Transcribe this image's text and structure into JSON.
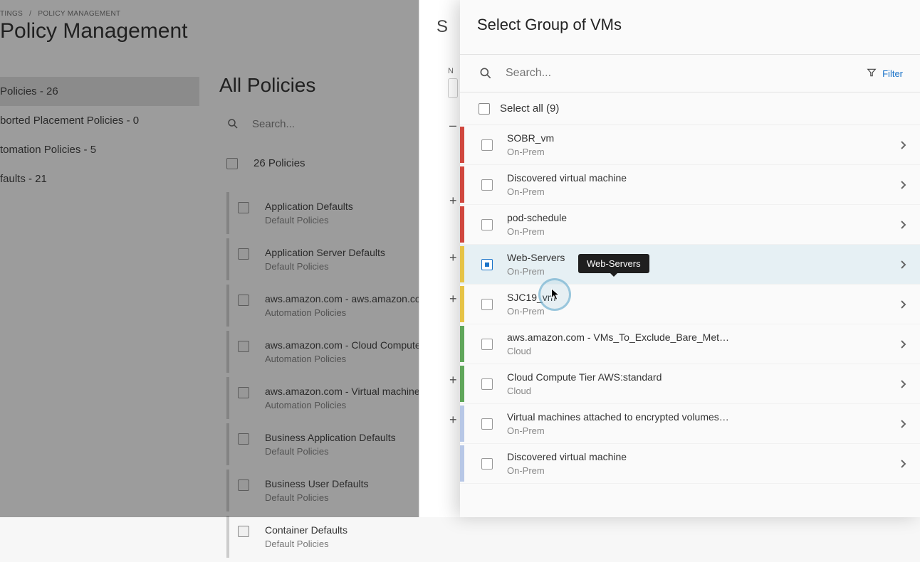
{
  "breadcrumb": {
    "a": "TINGS",
    "b": "POLICY MANAGEMENT"
  },
  "page_title": "Policy Management",
  "sidebar": {
    "items": [
      {
        "label": "Policies - 26"
      },
      {
        "label": "borted Placement Policies - 0"
      },
      {
        "label": "tomation Policies - 5"
      },
      {
        "label": "faults - 21"
      }
    ]
  },
  "mid": {
    "title": "All Policies",
    "search_placeholder": "Search...",
    "count_label": "26 Policies",
    "items": [
      {
        "name": "Application Defaults",
        "type": "Default Policies"
      },
      {
        "name": "Application Server Defaults",
        "type": "Default Policies"
      },
      {
        "name": "aws.amazon.com - aws.amazon.com - VM",
        "type": "Automation Policies"
      },
      {
        "name": "aws.amazon.com - Cloud Compute Tier A",
        "type": "Automation Policies"
      },
      {
        "name": "aws.amazon.com - Virtual machines attac",
        "type": "Automation Policies"
      },
      {
        "name": "Business Application Defaults",
        "type": "Default Policies"
      },
      {
        "name": "Business User Defaults",
        "type": "Default Policies"
      },
      {
        "name": "Container Defaults",
        "type": "Default Policies"
      }
    ]
  },
  "sheet1": {
    "peek_char": "S",
    "n_label": "N"
  },
  "panel": {
    "title": "Select Group of VMs",
    "search_placeholder": "Search...",
    "filter_label": "Filter",
    "select_all_label": "Select all (9)",
    "tooltip": "Web-Servers",
    "items": [
      {
        "name": "SOBR_vm",
        "sub": "On-Prem",
        "color": "red",
        "checked": false
      },
      {
        "name": "Discovered virtual machine",
        "sub": "On-Prem",
        "color": "red",
        "checked": false
      },
      {
        "name": "pod-schedule",
        "sub": "On-Prem",
        "color": "red",
        "checked": false
      },
      {
        "name": "Web-Servers",
        "sub": "On-Prem",
        "color": "yellow",
        "checked": true,
        "selected": true
      },
      {
        "name": "SJC19_vm",
        "sub": "On-Prem",
        "color": "yellow",
        "checked": false
      },
      {
        "name": "aws.amazon.com - VMs_To_Exclude_Bare_Met…",
        "sub": "Cloud",
        "color": "green",
        "checked": false
      },
      {
        "name": "Cloud Compute Tier AWS:standard",
        "sub": "Cloud",
        "color": "green",
        "checked": false
      },
      {
        "name": "Virtual machines attached to encrypted volumes…",
        "sub": "On-Prem",
        "color": "blue",
        "checked": false
      },
      {
        "name": "Discovered virtual machine",
        "sub": "On-Prem",
        "color": "blue",
        "checked": false
      }
    ]
  }
}
